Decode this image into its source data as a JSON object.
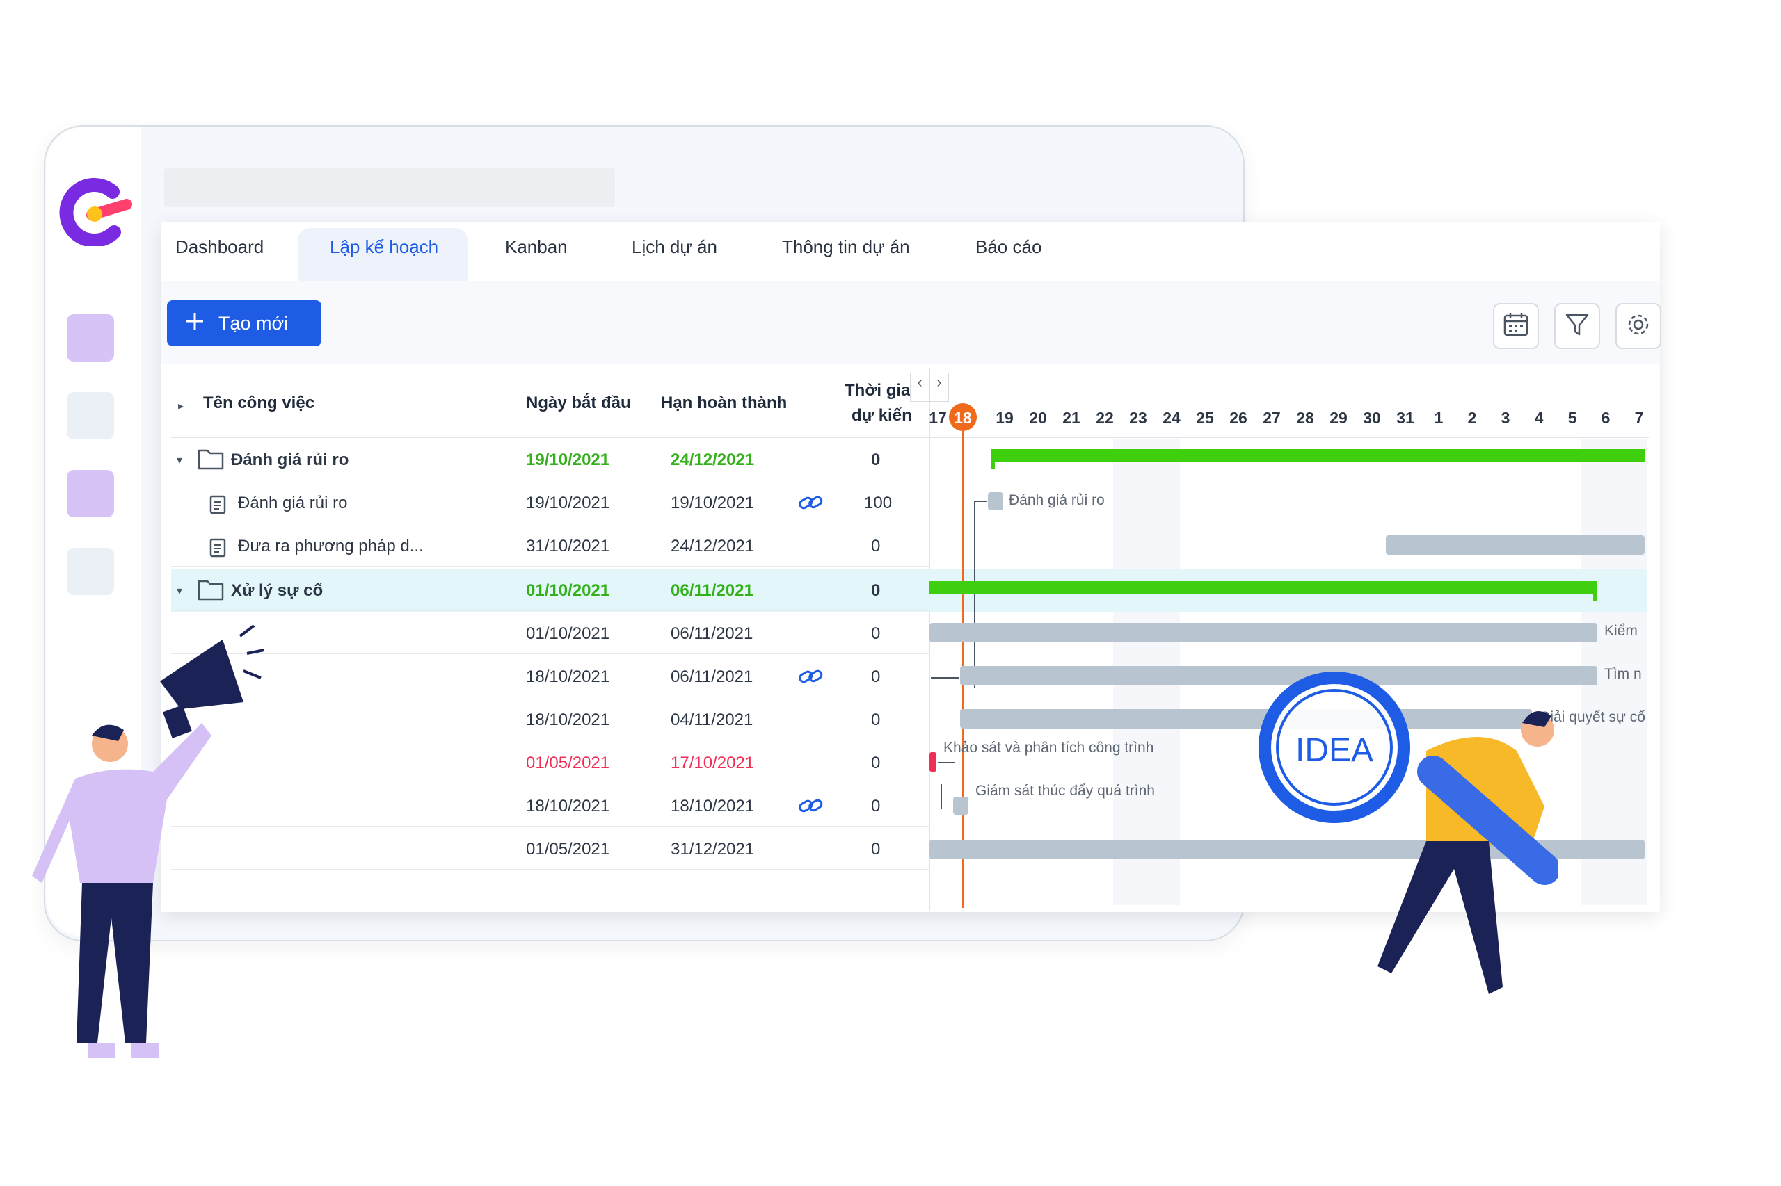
{
  "tabs": [
    "Dashboard",
    "Lập kế hoạch",
    "Kanban",
    "Lịch dự án",
    "Thông tin dự án",
    "Báo cáo"
  ],
  "active_tab": "Lập kế hoạch",
  "toolbar": {
    "create_label": "Tạo mới"
  },
  "columns": {
    "name": "Tên công việc",
    "start": "Ngày bắt đầu",
    "due": "Hạn hoàn thành",
    "duration_1": "Thời gian",
    "duration_2": "dự kiến"
  },
  "rows": [
    {
      "name": "Đánh giá rủi ro",
      "start": "19/10/2021",
      "due": "24/12/2021",
      "duration": "0"
    },
    {
      "name": "Đánh giá rủi ro",
      "start": "19/10/2021",
      "due": "19/10/2021",
      "duration": "100"
    },
    {
      "name": "Đưa ra phương pháp d...",
      "start": "31/10/2021",
      "due": "24/12/2021",
      "duration": "0"
    },
    {
      "name": "Xử lý sự cố",
      "start": "01/10/2021",
      "due": "06/11/2021",
      "duration": "0"
    },
    {
      "name": "",
      "start": "01/10/2021",
      "due": "06/11/2021",
      "duration": "0"
    },
    {
      "name": "",
      "start": "18/10/2021",
      "due": "06/11/2021",
      "duration": "0"
    },
    {
      "name": "",
      "start": "18/10/2021",
      "due": "04/11/2021",
      "duration": "0"
    },
    {
      "name": "",
      "start": "01/05/2021",
      "due": "17/10/2021",
      "duration": "0"
    },
    {
      "name": "",
      "start": "18/10/2021",
      "due": "18/10/2021",
      "duration": "0"
    },
    {
      "name": "",
      "start": "01/05/2021",
      "due": "31/12/2021",
      "duration": "0"
    }
  ],
  "timeline_days": [
    "17",
    "18",
    "19",
    "20",
    "21",
    "22",
    "23",
    "24",
    "25",
    "26",
    "27",
    "28",
    "29",
    "30",
    "31",
    "1",
    "2",
    "3",
    "4",
    "5",
    "6",
    "7"
  ],
  "today_day": "18",
  "gantt_labels": {
    "risk": "Đánh giá rủi ro",
    "check": "Kiểm",
    "find": "Tìm n",
    "solve": "Giải quyết sự cố",
    "survey": "Khảo sát và phân tích công trình",
    "monitor": "Giám sát thúc đẩy quá trình"
  },
  "illustration_text": "IDEA",
  "colors": {
    "brand_blue": "#1e5ce6",
    "green": "#3ecf0e",
    "today": "#f06a1b",
    "bar": "#b8c5d1",
    "accent_red": "#ef2d55"
  },
  "icons": [
    "app-logo",
    "plus-icon",
    "calendar-icon",
    "filter-icon",
    "settings-icon",
    "link-icon",
    "folder-icon",
    "task-icon",
    "chevron-left-icon",
    "chevron-right-icon",
    "megaphone-icon",
    "magnifier-icon"
  ]
}
